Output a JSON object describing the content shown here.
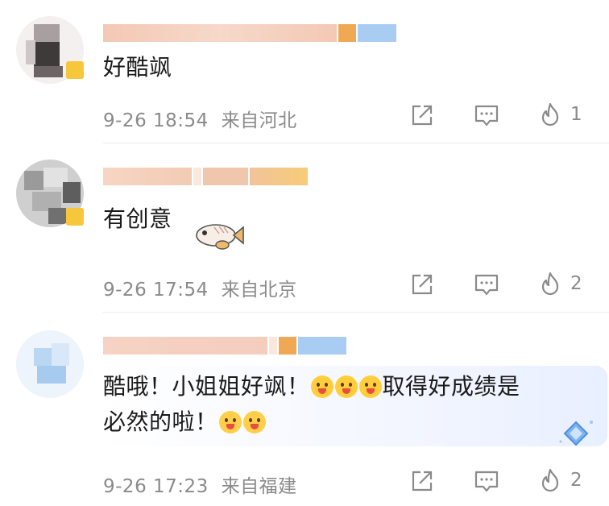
{
  "comments": [
    {
      "text": "好酷飒",
      "time": "9-26 18:54",
      "location": "来自河北",
      "likes": "1"
    },
    {
      "text": "有创意",
      "time": "9-26 17:54",
      "location": "来自北京",
      "likes": "2"
    },
    {
      "text_line1": "酷哦！小姐姐好飒！",
      "text_line1_after": "取得好成绩是",
      "text_line2": "必然的啦！",
      "time": "9-26 17:23",
      "location": "来自福建",
      "likes": "2"
    }
  ],
  "icons": {
    "share": "share-icon",
    "comment": "comment-icon",
    "like": "flame-icon",
    "sticker": "fish-sticker-icon",
    "badge": "diamond-badge-icon"
  },
  "colors": {
    "meta_text": "#8a8a8a",
    "badge_yellow": "#f6c73a",
    "badge_blue": "#7fb3f0"
  }
}
